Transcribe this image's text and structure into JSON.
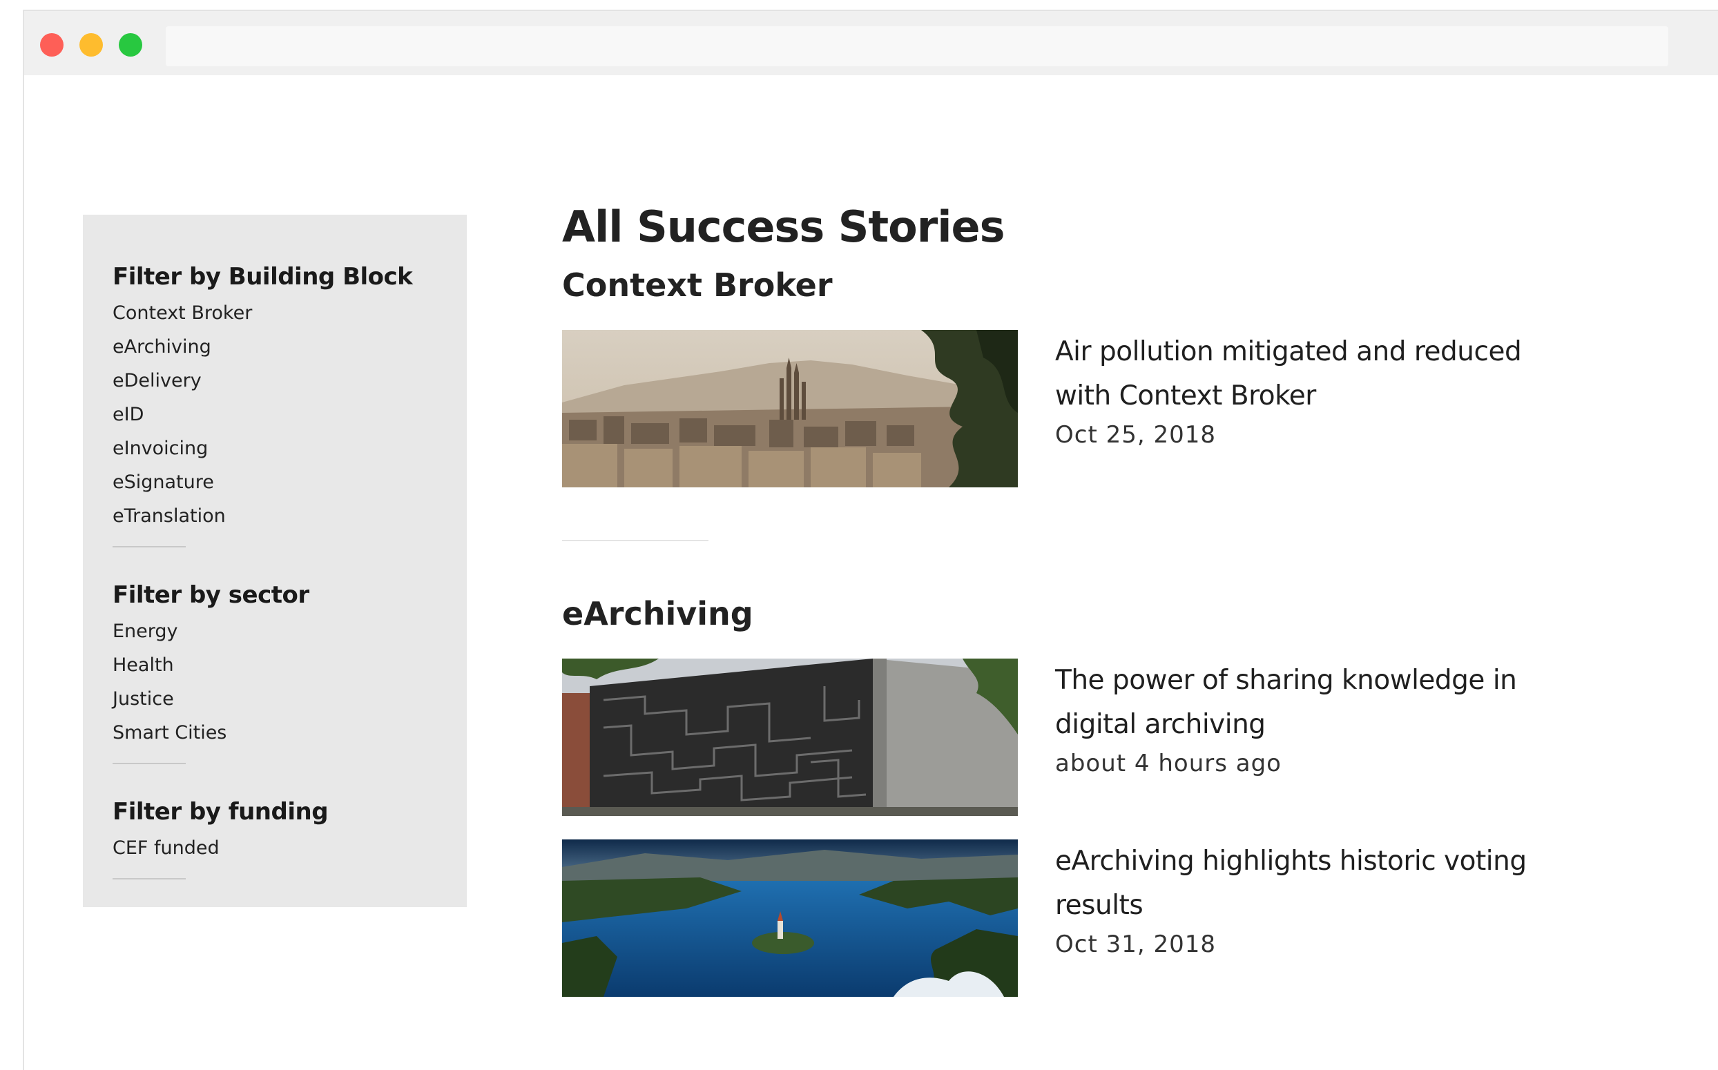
{
  "filters": [
    {
      "title": "Filter by Building Block",
      "items": [
        "Context Broker",
        "eArchiving",
        "eDelivery",
        "eID",
        "eInvoicing",
        "eSignature",
        "eTranslation"
      ]
    },
    {
      "title": "Filter by sector",
      "items": [
        "Energy",
        "Health",
        "Justice",
        "Smart Cities"
      ]
    },
    {
      "title": "Filter by funding",
      "items": [
        "CEF funded"
      ]
    }
  ],
  "main": {
    "title": "All Success Stories",
    "sections": [
      {
        "title": "Context Broker",
        "stories": [
          {
            "title": "Air pollution mitigated and reduced with Context Broker",
            "date": "Oct 25, 2018"
          }
        ]
      },
      {
        "title": "eArchiving",
        "stories": [
          {
            "title": "The power of sharing knowledge in digital archiving",
            "date": "about 4 hours ago"
          },
          {
            "title": "eArchiving highlights historic voting results",
            "date": "Oct 31, 2018"
          }
        ]
      }
    ]
  },
  "colors": {
    "close": "#fe5f57",
    "minimize": "#febc2e",
    "maximize": "#28c840",
    "sidebar_bg": "#e8e8e8"
  }
}
